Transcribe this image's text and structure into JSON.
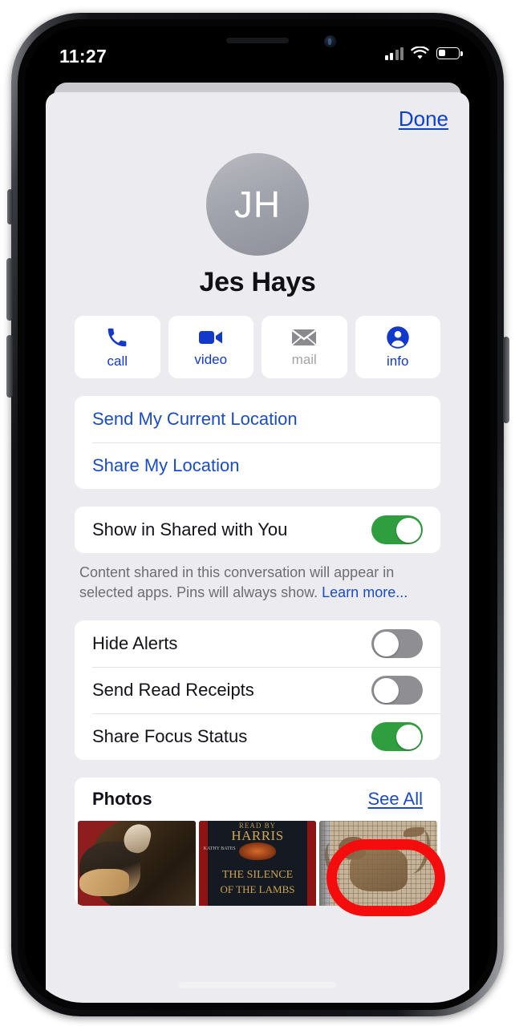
{
  "status_bar": {
    "time": "11:27",
    "signal_icon": "cellular-bars-icon",
    "wifi_icon": "wifi-icon",
    "battery_icon": "battery-low-icon"
  },
  "sheet": {
    "done_label": "Done",
    "contact": {
      "initials": "JH",
      "name": "Jes Hays"
    },
    "actions": [
      {
        "label": "call",
        "icon": "phone-icon",
        "enabled": true
      },
      {
        "label": "video",
        "icon": "video-camera-icon",
        "enabled": true
      },
      {
        "label": "mail",
        "icon": "envelope-icon",
        "enabled": false
      },
      {
        "label": "info",
        "icon": "person-circle-icon",
        "enabled": true
      }
    ],
    "location_rows": [
      {
        "label": "Send My Current Location"
      },
      {
        "label": "Share My Location"
      }
    ],
    "shared_with_you": {
      "label": "Show in Shared with You",
      "toggle_state": "on",
      "footnote": "Content shared in this conversation will appear in selected apps. Pins will always show. ",
      "footnote_link": "Learn more..."
    },
    "settings_rows": [
      {
        "label": "Hide Alerts",
        "toggle_state": "off"
      },
      {
        "label": "Send Read Receipts",
        "toggle_state": "off"
      },
      {
        "label": "Share Focus Status",
        "toggle_state": "on"
      }
    ],
    "photos": {
      "title": "Photos",
      "see_all_label": "See All",
      "thumbnails": [
        {
          "name": "dog-photo-thumbnail"
        },
        {
          "name": "silence-of-the-lambs-book-cover-thumbnail",
          "author": "HARRIS",
          "byline": "READ BY",
          "narrator": "KATHY BATES",
          "title_line_1": "THE SILENCE",
          "title_line_2": "OF THE LAMBS"
        },
        {
          "name": "mosaic-animal-thumbnail"
        }
      ]
    }
  },
  "annotation": {
    "shape": "red-oval-highlight",
    "color": "#f50d0d",
    "targets": "See All"
  },
  "colors": {
    "accent_blue": "#1b4bc4",
    "toggle_on_green": "#2e9e3e",
    "toggle_off_gray": "#8e8e93",
    "sheet_bg": "#ebebf0",
    "card_bg": "#ffffff"
  }
}
